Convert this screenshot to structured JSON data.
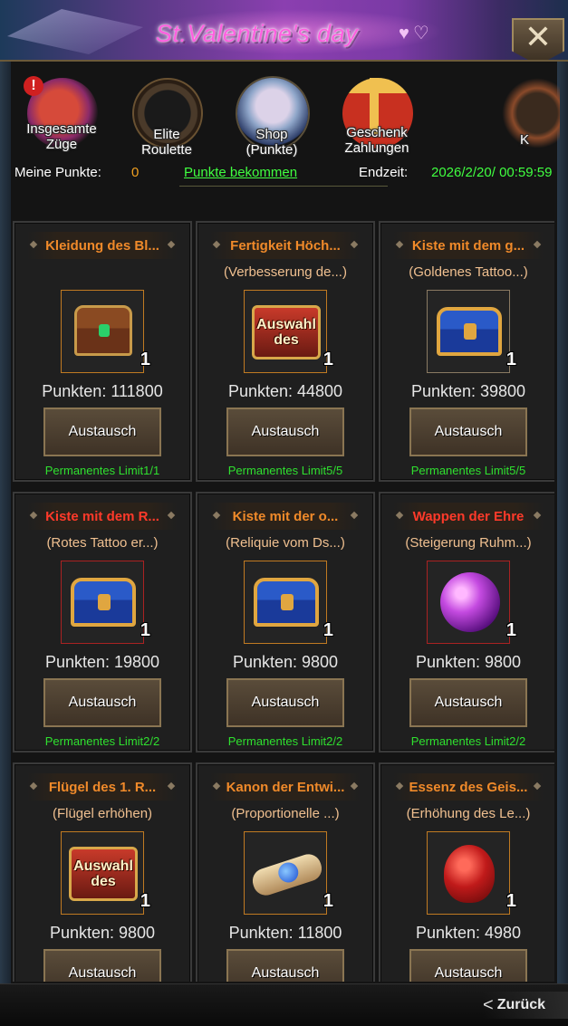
{
  "banner": {
    "title": "St.Valentine's day"
  },
  "tabs": [
    {
      "label_line1": "Insgesamte",
      "label_line2": "Züge",
      "icon": "koi-fish-icon"
    },
    {
      "label_line1": "Elite",
      "label_line2": "Roulette",
      "icon": "roulette-icon"
    },
    {
      "label_line1": "Shop",
      "label_line2": "(Punkte)",
      "icon": "shop-girl-icon",
      "active": true
    },
    {
      "label_line1": "Geschenk",
      "label_line2": "Zahlungen",
      "icon": "gift-icon"
    },
    {
      "label_line1": "K",
      "label_line2": "",
      "icon": "partial-tab-icon"
    }
  ],
  "info": {
    "my_points_label": "Meine Punkte:",
    "my_points_value": "0",
    "get_points_link": "Punkte bekommen",
    "end_label": "Endzeit:",
    "end_value": "2026/2/20/ 00:59:59"
  },
  "items": [
    {
      "name": "Kleidung des Bl...",
      "name_color": "orange",
      "sub": "",
      "art": "wood-chest-icon",
      "count": "1",
      "price": "Punkten: 111800",
      "button": "Austausch",
      "limit": "Permanentes Limit1/1"
    },
    {
      "name": "Fertigkeit Höch...",
      "name_color": "orange",
      "sub": "(Verbesserung de...)",
      "art": "selection-chest-icon",
      "art_text": "Auswahl des",
      "count": "1",
      "price": "Punkten: 44800",
      "button": "Austausch",
      "limit": "Permanentes Limit5/5"
    },
    {
      "name": "Kiste mit dem g...",
      "name_color": "orange",
      "sub": "(Goldenes Tattoo...)",
      "art": "blue-chest-icon",
      "count": "1",
      "price": "Punkten: 39800",
      "button": "Austausch",
      "limit": "Permanentes Limit5/5"
    },
    {
      "name": "Kiste mit dem R...",
      "name_color": "red",
      "sub": "(Rotes Tattoo er...)",
      "art": "blue-chest-icon",
      "count": "1",
      "price": "Punkten: 19800",
      "button": "Austausch",
      "limit": "Permanentes Limit2/2"
    },
    {
      "name": "Kiste mit der o...",
      "name_color": "orange",
      "sub": "(Reliquie vom Ds...)",
      "art": "blue-chest-icon",
      "count": "1",
      "price": "Punkten: 9800",
      "button": "Austausch",
      "limit": "Permanentes Limit2/2"
    },
    {
      "name": "Wappen der Ehre",
      "name_color": "red",
      "sub": "(Steigerung Ruhm...)",
      "art": "purple-orb-icon",
      "count": "1",
      "price": "Punkten: 9800",
      "button": "Austausch",
      "limit": "Permanentes Limit2/2"
    },
    {
      "name": "Flügel des 1. R...",
      "name_color": "orange",
      "sub": "(Flügel erhöhen)",
      "art": "selection-chest-icon",
      "art_text": "Auswahl des",
      "count": "1",
      "price": "Punkten: 9800",
      "button": "Austausch",
      "limit": ""
    },
    {
      "name": "Kanon der Entwi...",
      "name_color": "orange",
      "sub": "(Proportionelle ...)",
      "art": "scroll-icon",
      "count": "1",
      "price": "Punkten: 11800",
      "button": "Austausch",
      "limit": ""
    },
    {
      "name": "Essenz des Geis...",
      "name_color": "orange",
      "sub": "(Erhöhung des Le...)",
      "art": "red-essence-icon",
      "count": "1",
      "price": "Punkten: 4980",
      "button": "Austausch",
      "limit": ""
    }
  ],
  "footer": {
    "back_label": "Zurück"
  }
}
